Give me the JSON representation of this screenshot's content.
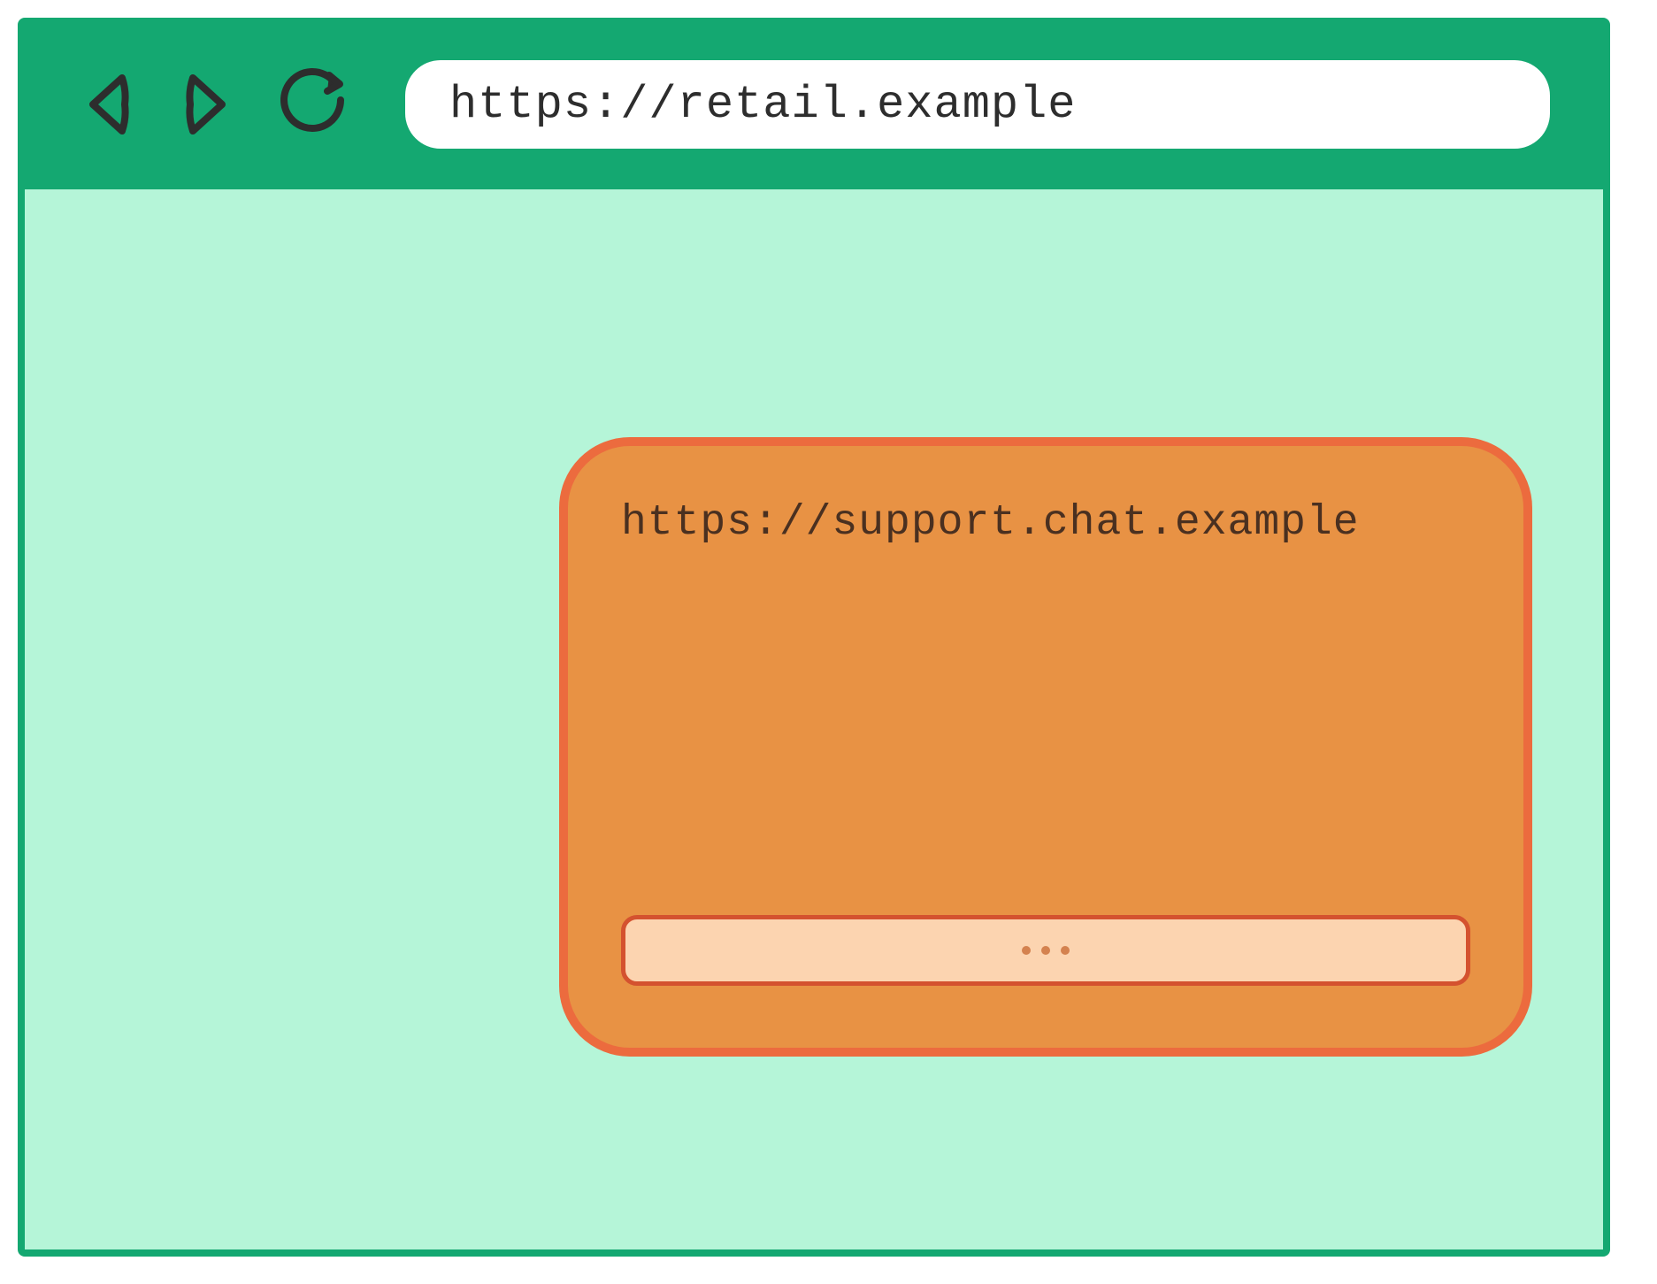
{
  "browser": {
    "url": "https://retail.example"
  },
  "chat_widget": {
    "url": "https://support.chat.example"
  }
}
